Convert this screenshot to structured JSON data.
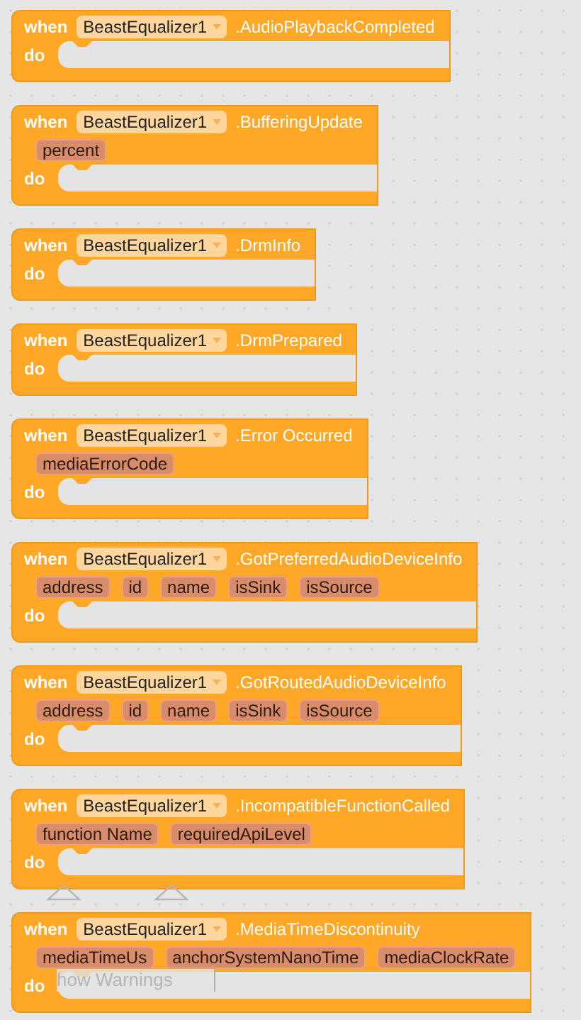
{
  "blocks": [
    {
      "when": "when",
      "component": "BeastEqualizer1",
      "event": ".AudioPlaybackCompleted",
      "do": "do"
    },
    {
      "when": "when",
      "component": "BeastEqualizer1",
      "event": ".BufferingUpdate",
      "params": [
        "percent"
      ],
      "do": "do"
    },
    {
      "when": "when",
      "component": "BeastEqualizer1",
      "event": ".DrmInfo",
      "do": "do"
    },
    {
      "when": "when",
      "component": "BeastEqualizer1",
      "event": ".DrmPrepared",
      "do": "do"
    },
    {
      "when": "when",
      "component": "BeastEqualizer1",
      "event": ".Error Occurred",
      "params": [
        "mediaErrorCode"
      ],
      "do": "do"
    },
    {
      "when": "when",
      "component": "BeastEqualizer1",
      "event": ".GotPreferredAudioDeviceInfo",
      "params": [
        "address",
        "id",
        "name",
        "isSink",
        "isSource"
      ],
      "do": "do"
    },
    {
      "when": "when",
      "component": "BeastEqualizer1",
      "event": ".GotRoutedAudioDeviceInfo",
      "params": [
        "address",
        "id",
        "name",
        "isSink",
        "isSource"
      ],
      "do": "do"
    },
    {
      "when": "when",
      "component": "BeastEqualizer1",
      "event": ".IncompatibleFunctionCalled",
      "params": [
        "function Name",
        "requiredApiLevel"
      ],
      "do": "do"
    },
    {
      "when": "when",
      "component": "BeastEqualizer1",
      "event": ".MediaTimeDiscontinuity",
      "params": [
        "mediaTimeUs",
        "anchorSystemNanoTime",
        "mediaClockRate"
      ],
      "do": "do"
    }
  ],
  "show_warnings": {
    "label": "how Warnings"
  }
}
